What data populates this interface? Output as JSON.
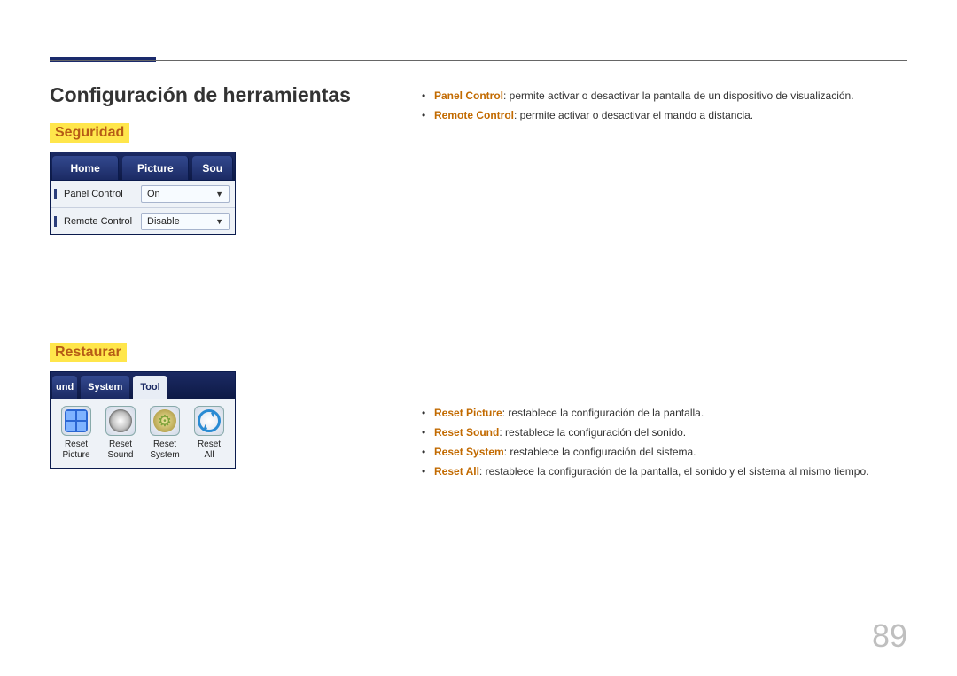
{
  "header": {
    "title": "Configuración de herramientas"
  },
  "seguridad": {
    "heading": "Seguridad",
    "tabs": {
      "home": "Home",
      "picture": "Picture",
      "sound": "Sou"
    },
    "rows": {
      "panel": {
        "label": "Panel Control",
        "value": "On"
      },
      "remote": {
        "label": "Remote Control",
        "value": "Disable"
      }
    },
    "desc": {
      "panel": {
        "term": "Panel Control",
        "text": ": permite activar o desactivar la pantalla de un dispositivo de visualización."
      },
      "remote": {
        "term": "Remote Control",
        "text": ": permite activar o desactivar el mando a distancia."
      }
    }
  },
  "restaurar": {
    "heading": "Restaurar",
    "tabs": {
      "und": "und",
      "system": "System",
      "tool": "Tool"
    },
    "items": {
      "picture": "Reset\nPicture",
      "sound": "Reset\nSound",
      "system": "Reset\nSystem",
      "all": "Reset\nAll"
    },
    "desc": {
      "picture": {
        "term": "Reset Picture",
        "text": ": restablece la configuración de la pantalla."
      },
      "sound": {
        "term": "Reset Sound",
        "text": ": restablece la configuración del sonido."
      },
      "system": {
        "term": "Reset System",
        "text": ": restablece la configuración del sistema."
      },
      "all": {
        "term": "Reset All",
        "text": ": restablece la configuración de la pantalla, el sonido y el sistema al mismo tiempo."
      }
    }
  },
  "page_number": "89"
}
